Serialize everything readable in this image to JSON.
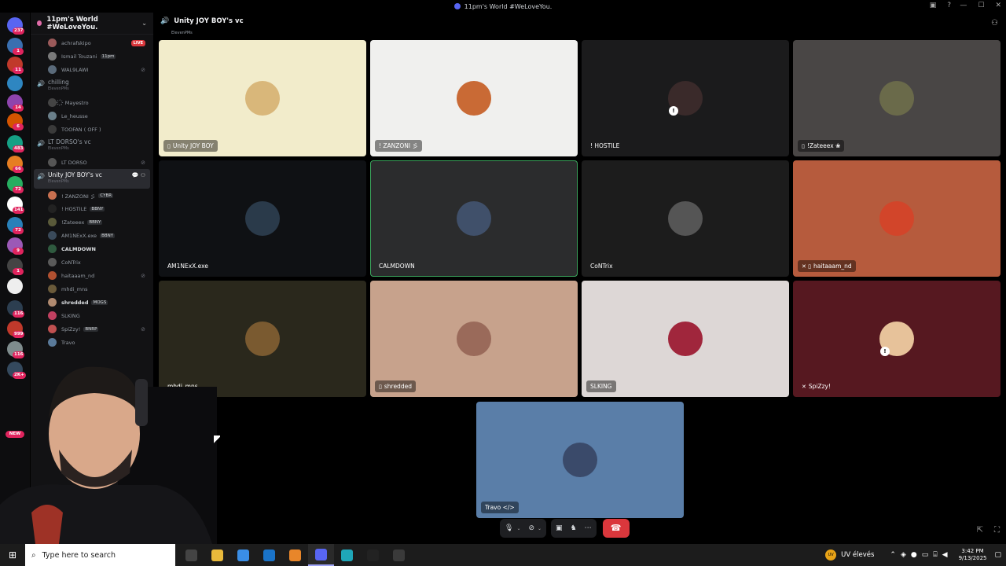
{
  "window": {
    "title": "11pm's World #WeLoveYou."
  },
  "rail": {
    "badges": [
      {
        "icon": "discord-home-icon",
        "color": "#5865f2",
        "badge": "237"
      },
      {
        "icon": "server-icon-1",
        "color": "#3a6fb0",
        "badge": "1"
      },
      {
        "icon": "server-icon-2",
        "color": "#c0392b",
        "badge": "11"
      },
      {
        "icon": "server-icon-3",
        "color": "#2e86c1",
        "badge": ""
      },
      {
        "icon": "server-icon-4",
        "color": "#8e44ad",
        "badge": "14"
      },
      {
        "icon": "server-icon-5",
        "color": "#d35400",
        "badge": "6"
      },
      {
        "icon": "server-icon-6",
        "color": "#16a085",
        "badge": "483"
      },
      {
        "icon": "server-icon-7",
        "color": "#e67e22",
        "badge": "66"
      },
      {
        "icon": "server-icon-8",
        "color": "#27ae60",
        "badge": "72"
      },
      {
        "icon": "server-icon-9",
        "color": "#ffffff",
        "badge": "141"
      },
      {
        "icon": "server-icon-10",
        "color": "#2980b9",
        "badge": "72"
      },
      {
        "icon": "server-icon-11",
        "color": "#9b59b6",
        "badge": "9"
      },
      {
        "icon": "server-icon-12",
        "color": "#444444",
        "badge": "1"
      },
      {
        "icon": "server-icon-13",
        "color": "#eeeeee",
        "badge": ""
      },
      {
        "icon": "server-icon-14",
        "color": "#2c3e50",
        "badge": "116"
      },
      {
        "icon": "server-icon-15",
        "color": "#c0392b",
        "badge": "999"
      },
      {
        "icon": "server-icon-16",
        "color": "#7f8c8d",
        "badge": "116"
      },
      {
        "icon": "server-icon-17",
        "color": "#34495e",
        "badge": "2K+"
      }
    ],
    "new_label": "NEW"
  },
  "sidebar": {
    "server_name": "11pm's World #WeLoveYou.",
    "top_members": [
      {
        "name": "achrafskipo",
        "tag": "",
        "live": "LIVE",
        "color": "#9b5a5a"
      },
      {
        "name": "Ismail Touzani",
        "tag": "11pm",
        "live": "",
        "color": "#7a7a7a"
      },
      {
        "name": "WAL9LAWI",
        "tag": "",
        "live": "",
        "color": "#5a6a7a",
        "muted": true
      }
    ],
    "channels": [
      {
        "name": "chilling",
        "sub": "ElevenPMs",
        "members": [
          {
            "name": "҉ Mayestro",
            "tag": "",
            "color": "#444"
          },
          {
            "name": "Le_heusse",
            "tag": "",
            "color": "#6a7f8a"
          },
          {
            "name": "TOOFAN ( OFF )",
            "tag": "",
            "color": "#3a3a3a"
          }
        ]
      },
      {
        "name": "LT DORSO's vc",
        "sub": "ElevenPMs",
        "members": [
          {
            "name": "LT DORSO",
            "tag": "",
            "color": "#555",
            "muted": true
          }
        ]
      }
    ],
    "active_channel": {
      "name": "Unity JOY BOY's vc",
      "sub": "ElevenPMs",
      "members": [
        {
          "name": "! ZANZONI 彡",
          "tag": "CYBR",
          "color": "#c87050",
          "bright": false
        },
        {
          "name": "! HOSTILE",
          "tag": "BBNY",
          "color": "#222",
          "bright": false
        },
        {
          "name": "!Zateeex",
          "tag": "BBNY",
          "color": "#5a5a3a",
          "bright": false
        },
        {
          "name": "AM1NExX.exe",
          "tag": "BBNY",
          "color": "#3a4a5a",
          "bright": false
        },
        {
          "name": "CALMDOWN",
          "tag": "",
          "color": "#2f5a3f",
          "bright": true
        },
        {
          "name": "CoNTrix",
          "tag": "",
          "color": "#5a5a5a",
          "bright": false
        },
        {
          "name": "haitaaam_nd",
          "tag": "",
          "color": "#b05030",
          "bright": false,
          "muted": true
        },
        {
          "name": "mhdi_mns",
          "tag": "",
          "color": "#6a5a3a",
          "bright": false
        },
        {
          "name": "shredded",
          "tag": "MOGS",
          "color": "#b08a70",
          "bright": true
        },
        {
          "name": "SLKING",
          "tag": "",
          "color": "#c04060",
          "bright": false
        },
        {
          "name": "SpiZzy!",
          "tag": "BNRP",
          "color": "#c05050",
          "bright": false,
          "muted": true
        },
        {
          "name": "Travo",
          "tag": "",
          "color": "#5a7a9a",
          "bright": false
        }
      ]
    }
  },
  "main": {
    "title": "Unity JOY BOY's vc",
    "subtitle": "ElevenPMs",
    "tiles": [
      {
        "name": "Unity JOY BOY",
        "bg": "#f2eccb",
        "avatar": "#d9b77a",
        "prefix": "▯",
        "label_bg": true,
        "speaking": false
      },
      {
        "name": "! ZANZONI 彡",
        "bg": "#f0f0ee",
        "avatar": "#c96a35",
        "prefix": "",
        "label_bg": true,
        "speaking": false
      },
      {
        "name": "! HOSTILE",
        "bg": "#1b1b1c",
        "avatar": "#3a2a2a",
        "prefix": "",
        "label_bg": false,
        "speaking": false,
        "badge": "!"
      },
      {
        "name": "!Zateeex ❀",
        "bg": "#494645",
        "avatar": "#6a6a4a",
        "prefix": "▯",
        "label_bg": true,
        "speaking": false
      },
      {
        "name": "AM1NExX.exe",
        "bg": "#0f1114",
        "avatar": "#2a3a4a",
        "prefix": "",
        "label_bg": false,
        "speaking": false
      },
      {
        "name": "CALMDOWN",
        "bg": "#2b2c2d",
        "avatar": "#40506a",
        "prefix": "",
        "label_bg": false,
        "speaking": true
      },
      {
        "name": "CoNTrix",
        "bg": "#1c1c1c",
        "avatar": "#555",
        "prefix": "",
        "label_bg": false,
        "speaking": false
      },
      {
        "name": "haitaaam_nd",
        "bg": "#b65b3d",
        "avatar": "#d2452a",
        "prefix": "✕ ▯",
        "label_bg": true,
        "speaking": false
      },
      {
        "name": "mhdi_mns",
        "bg": "#2a281c",
        "avatar": "#7a5a30",
        "prefix": "",
        "label_bg": false,
        "speaking": false
      },
      {
        "name": "shredded",
        "bg": "#c7a28c",
        "avatar": "#9a6a5a",
        "prefix": "▯",
        "label_bg": true,
        "speaking": false
      },
      {
        "name": "SLKING",
        "bg": "#ddd7d6",
        "avatar": "#a0263c",
        "prefix": "",
        "label_bg": true,
        "speaking": false
      },
      {
        "name": "SpiZzy!",
        "bg": "#561820",
        "avatar": "#e7c29a",
        "prefix": "✕",
        "label_bg": false,
        "speaking": false,
        "badge": "!"
      },
      {
        "name": "Travo </>",
        "bg": "#5a7ea8",
        "avatar": "#3a4a6a",
        "prefix": "",
        "label_bg": true,
        "speaking": false
      }
    ]
  },
  "controls": {
    "mic_icon": "🎙",
    "camera_icon": "⊘",
    "screen_icon": "▣",
    "activity_icon": "♞",
    "more_icon": "⋯",
    "hangup_icon": "☎"
  },
  "taskbar": {
    "search_placeholder": "Type here to search",
    "apps": [
      {
        "name": "task-view",
        "color": "#444"
      },
      {
        "name": "file-explorer",
        "color": "#e8b93b"
      },
      {
        "name": "ms-store",
        "color": "#3a8ee6"
      },
      {
        "name": "outlook",
        "color": "#1a73c8"
      },
      {
        "name": "app-orange",
        "color": "#e8862a"
      },
      {
        "name": "discord",
        "color": "#5865f2",
        "active": true
      },
      {
        "name": "edge",
        "color": "#1fa6b8"
      },
      {
        "name": "obs",
        "color": "#222"
      },
      {
        "name": "app-dark",
        "color": "#3a3a3a"
      }
    ],
    "weather_label": "UV",
    "weather_text": "UV élevés",
    "time": "3:42 PM",
    "date": "9/13/2025"
  }
}
